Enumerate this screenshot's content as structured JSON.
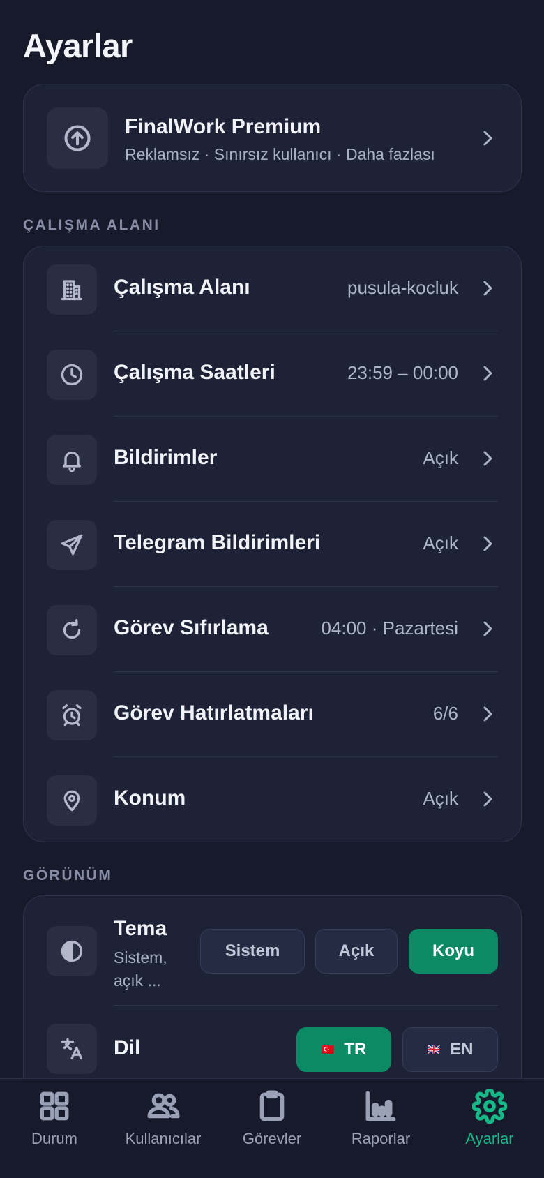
{
  "page": {
    "title": "Ayarlar"
  },
  "premium": {
    "title": "FinalWork Premium",
    "subtitle": "Reklamsız · Sınırsız kullanıcı · Daha fazlası",
    "icon": "arrow-up-circle-icon"
  },
  "sections": {
    "workspace": "ÇALIŞMA ALANI",
    "appearance": "GÖRÜNÜM"
  },
  "settings": [
    {
      "label": "Çalışma Alanı",
      "value": "pusula-kocluk",
      "icon": "building-icon"
    },
    {
      "label": "Çalışma Saatleri",
      "value": "23:59 – 00:00",
      "icon": "clock-icon"
    },
    {
      "label": "Bildirimler",
      "value": "Açık",
      "icon": "bell-icon"
    },
    {
      "label": "Telegram Bildirimleri",
      "value": "Açık",
      "icon": "send-icon"
    },
    {
      "label": "Görev Sıfırlama",
      "value": "04:00 · Pazartesi",
      "icon": "refresh-icon"
    },
    {
      "label": "Görev Hatırlatmaları",
      "value": "6/6",
      "icon": "alarm-clock-icon"
    },
    {
      "label": "Konum",
      "value": "Açık",
      "icon": "map-pin-icon"
    }
  ],
  "theme": {
    "title": "Tema",
    "description": "Sistem, açık ...",
    "options": [
      "Sistem",
      "Açık",
      "Koyu"
    ],
    "selected": "Koyu"
  },
  "language": {
    "title": "Dil",
    "options": [
      {
        "flag": "🇹🇷",
        "code": "TR"
      },
      {
        "flag": "🇬🇧",
        "code": "EN"
      }
    ],
    "selected": "TR"
  },
  "tabs": [
    {
      "label": "Durum",
      "icon": "grid-icon"
    },
    {
      "label": "Kullanıcılar",
      "icon": "users-icon"
    },
    {
      "label": "Görevler",
      "icon": "clipboard-icon"
    },
    {
      "label": "Raporlar",
      "icon": "bar-chart-icon"
    },
    {
      "label": "Ayarlar",
      "icon": "gear-icon"
    }
  ],
  "active_tab": "Ayarlar",
  "colors": {
    "background": "#171a2a",
    "card": "#1e2236",
    "accent": "#0c8a64",
    "active_tab": "#16b888"
  }
}
